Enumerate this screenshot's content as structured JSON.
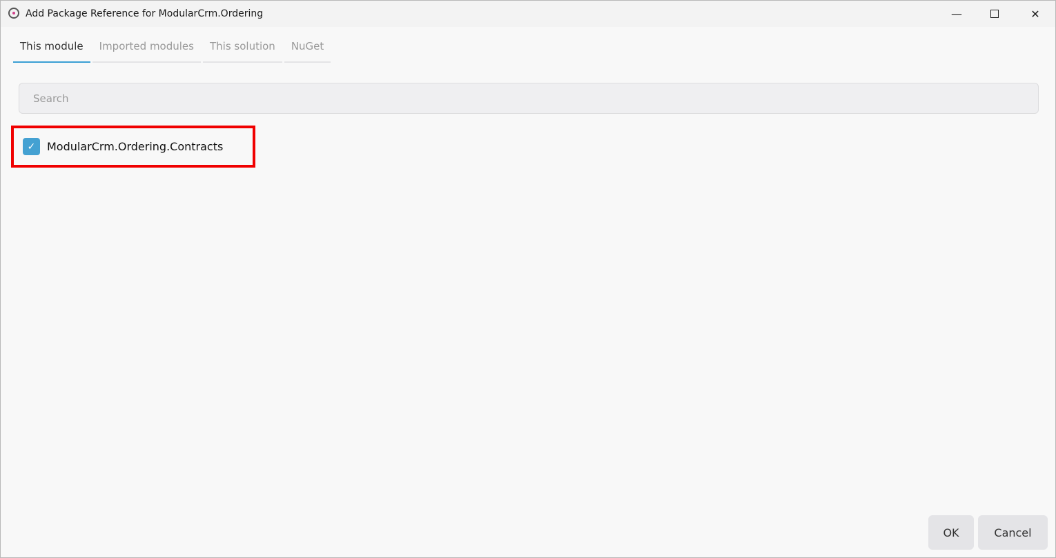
{
  "window": {
    "title": "Add Package Reference for ModularCrm.Ordering",
    "app_icon": "app-logo-icon",
    "controls": [
      "minimize-icon",
      "maximize-icon",
      "close-icon"
    ]
  },
  "tabs": [
    {
      "label": "This module",
      "active": true
    },
    {
      "label": "Imported modules",
      "active": false
    },
    {
      "label": "This solution",
      "active": false
    },
    {
      "label": "NuGet",
      "active": false
    }
  ],
  "search": {
    "placeholder": "Search",
    "value": ""
  },
  "items": [
    {
      "label": "ModularCrm.Ordering.Contracts",
      "checked": true
    }
  ],
  "buttons": {
    "ok": "OK",
    "cancel": "Cancel"
  },
  "colors": {
    "accent": "#3a9fd4",
    "checkbox": "#44a1d2",
    "highlight": "#f00000"
  }
}
